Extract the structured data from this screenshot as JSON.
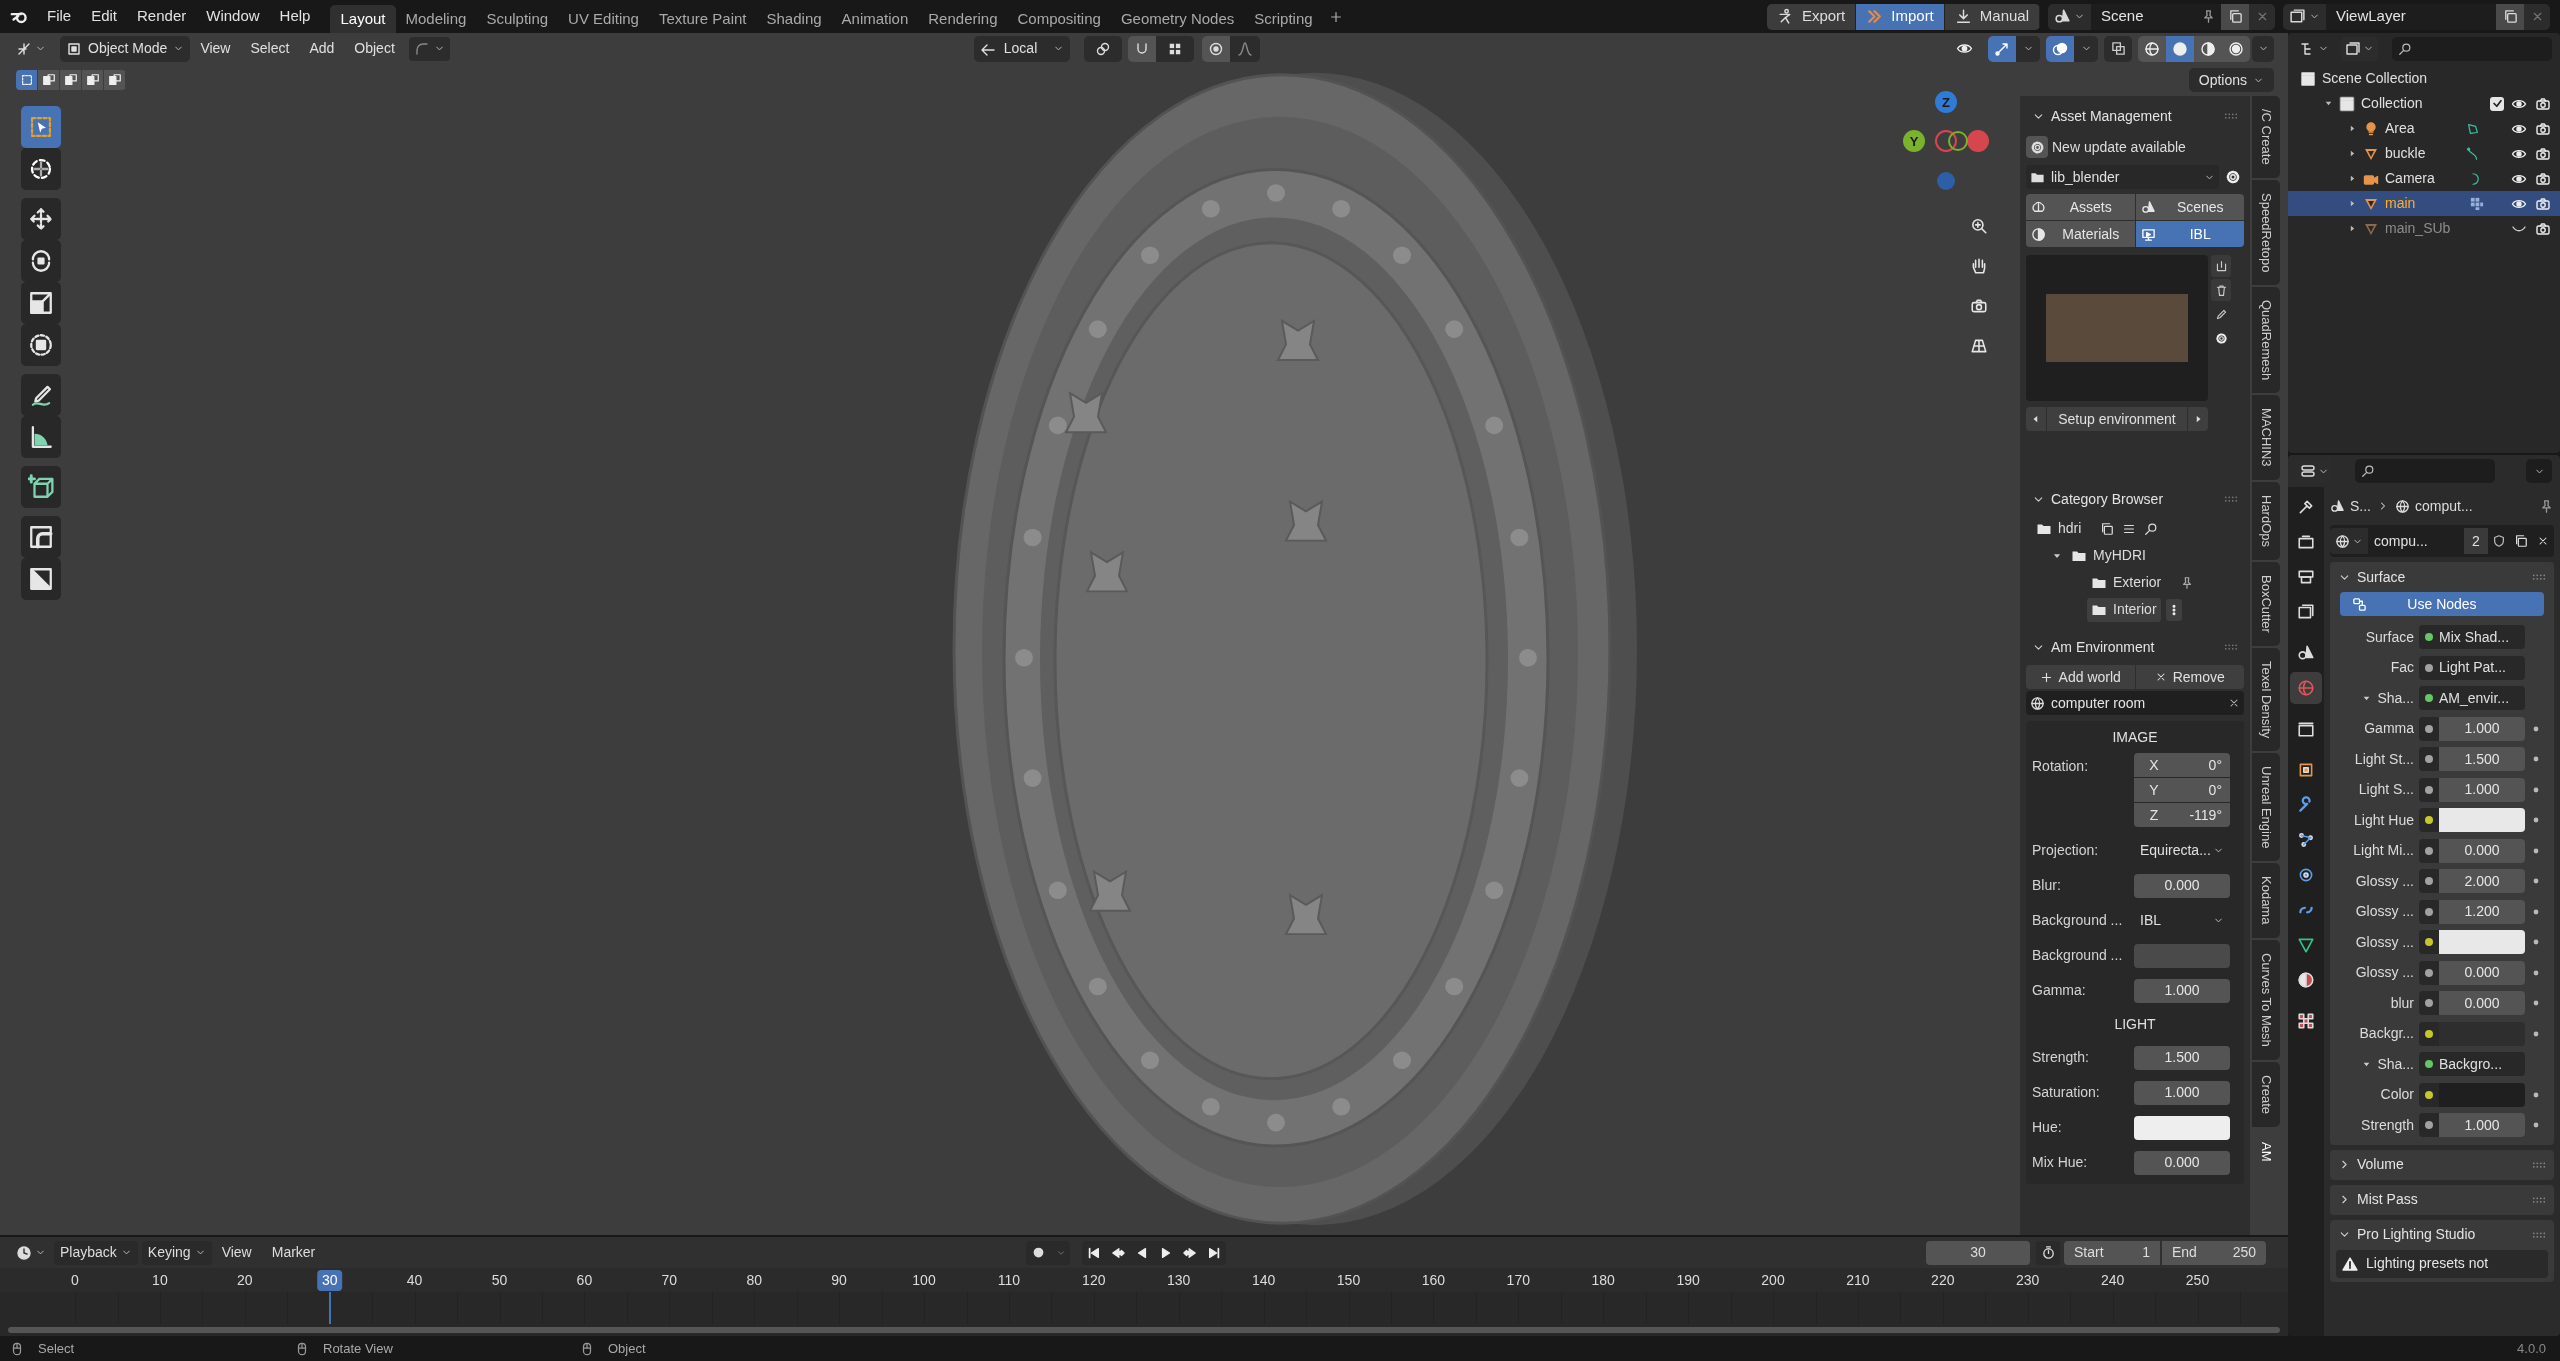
{
  "menu_bar": [
    "File",
    "Edit",
    "Render",
    "Window",
    "Help"
  ],
  "workspaces": [
    {
      "label": "Layout",
      "selected": true
    },
    {
      "label": "Modeling",
      "selected": false
    },
    {
      "label": "Sculpting",
      "selected": false
    },
    {
      "label": "UV Editing",
      "selected": false
    },
    {
      "label": "Texture Paint",
      "selected": false
    },
    {
      "label": "Shading",
      "selected": false
    },
    {
      "label": "Animation",
      "selected": false
    },
    {
      "label": "Rendering",
      "selected": false
    },
    {
      "label": "Compositing",
      "selected": false
    },
    {
      "label": "Geometry Nodes",
      "selected": false
    },
    {
      "label": "Scripting",
      "selected": false
    }
  ],
  "header_buttons": [
    {
      "label": "Export",
      "selected": false
    },
    {
      "label": "Import",
      "selected": true
    },
    {
      "label": "Manual",
      "selected": false
    }
  ],
  "scene": "Scene",
  "view_layer": "ViewLayer",
  "viewport_header": {
    "mode": "Object Mode",
    "menus": [
      "View",
      "Select",
      "Add",
      "Object"
    ],
    "orientation": "Local",
    "options": "Options"
  },
  "shading_modes": [
    {
      "selected": false
    },
    {
      "selected": true
    },
    {
      "selected": false
    },
    {
      "selected": false
    }
  ],
  "select_modes": [
    {
      "selected": true
    },
    {
      "selected": false
    },
    {
      "selected": false
    },
    {
      "selected": false
    },
    {
      "selected": false
    }
  ],
  "tools": [
    {
      "selected": true
    },
    {
      "selected": false
    },
    {
      "selected": false
    },
    {
      "selected": false
    },
    {
      "selected": false
    },
    {
      "selected": false
    },
    {
      "selected": false
    },
    {
      "selected": false
    },
    {
      "selected": false
    },
    {
      "selected": false
    },
    {
      "selected": false
    }
  ],
  "gizmo": {
    "axes": [
      "Z",
      "Y"
    ]
  },
  "n_panel": {
    "asset_management": {
      "title": "Asset Management",
      "expanded": true,
      "update_notice": "New update available",
      "library": "lib_blender",
      "tabs": [
        {
          "label": "Assets",
          "selected": false
        },
        {
          "label": "Scenes",
          "selected": false
        },
        {
          "label": "Materials",
          "selected": false
        },
        {
          "label": "IBL",
          "selected": true
        }
      ],
      "setup_button": "Setup environment"
    },
    "category_browser": {
      "title": "Category Browser",
      "expanded": true,
      "tree": [
        {
          "label": "hdri",
          "selected": false,
          "children": [
            {
              "label": "MyHDRI",
              "expanded": true,
              "selected": false,
              "children": [
                {
                  "label": "Exterior",
                  "selected": false
                },
                {
                  "label": "Interior",
                  "selected": true
                }
              ]
            }
          ]
        }
      ]
    },
    "am_environment": {
      "title": "Am Environment",
      "expanded": true,
      "add_button": "Add world",
      "remove_button": "Remove",
      "world": "computer room",
      "image_section": {
        "heading": "IMAGE",
        "rotation_label": "Rotation:",
        "rotation": [
          {
            "axis": "X",
            "value": "0°"
          },
          {
            "axis": "Y",
            "value": "0°"
          },
          {
            "axis": "Z",
            "value": "-119°"
          }
        ],
        "fields": [
          {
            "label": "Projection:",
            "kind": "dropdown",
            "value": "Equirecta..."
          },
          {
            "label": "Blur:",
            "kind": "number",
            "value": "0.000"
          },
          {
            "label": "Background ...",
            "kind": "dropdown",
            "value": "IBL"
          },
          {
            "label": "Background ...",
            "kind": "swatch",
            "swatch": {
              "color": "#4a4a4a"
            }
          },
          {
            "label": "Gamma:",
            "kind": "number",
            "value": "1.000"
          }
        ]
      },
      "light_section": {
        "heading": "LIGHT",
        "fields": [
          {
            "label": "Strength:",
            "kind": "number",
            "value": "1.500"
          },
          {
            "label": "Saturation:",
            "kind": "number",
            "value": "1.000"
          },
          {
            "label": "Hue:",
            "kind": "swatch",
            "swatch": {
              "color": "#eeeeee"
            }
          },
          {
            "label": "Mix Hue:",
            "kind": "number",
            "value": "0.000"
          }
        ]
      }
    }
  },
  "side_tabs": [
    {
      "label": "/C Create",
      "selected": false
    },
    {
      "label": "SpeedRetopo",
      "selected": false
    },
    {
      "label": "QuadRemesh",
      "selected": false
    },
    {
      "label": "MACHIN3",
      "selected": false
    },
    {
      "label": "HardOps",
      "selected": false
    },
    {
      "label": "BoxCutter",
      "selected": false
    },
    {
      "label": "Texel Density",
      "selected": false
    },
    {
      "label": "Unreal Engine",
      "selected": false
    },
    {
      "label": "Kodama",
      "selected": false
    },
    {
      "label": "Curves To Mesh",
      "selected": false
    },
    {
      "label": "Create",
      "selected": false
    },
    {
      "label": "AM",
      "selected": true
    }
  ],
  "outliner": {
    "tree": [
      {
        "label": "Scene Collection",
        "kind": "scene_collection",
        "children": [
          {
            "label": "Collection",
            "kind": "collection",
            "expanded": true,
            "checked": true,
            "visible": true,
            "children": [
              {
                "label": "Area",
                "kind": "light",
                "expanded": false,
                "selected": false,
                "visible": true,
                "modifiers": false
              },
              {
                "label": "buckle",
                "kind": "curve",
                "expanded": false,
                "selected": false,
                "visible": true,
                "modifiers": false
              },
              {
                "label": "Camera",
                "kind": "camera",
                "expanded": false,
                "selected": false,
                "visible": true,
                "modifiers": false
              },
              {
                "label": "main",
                "kind": "mesh",
                "expanded": false,
                "selected": true,
                "visible": true,
                "modifiers": true
              },
              {
                "label": "main_SUb",
                "kind": "mesh",
                "expanded": false,
                "selected": false,
                "visible": false,
                "modifiers": false
              }
            ]
          }
        ]
      }
    ]
  },
  "properties": {
    "tabs": [
      {
        "selected": false
      },
      {
        "selected": false
      },
      {
        "selected": false
      },
      {
        "selected": false
      },
      {
        "selected": false
      },
      {
        "selected": true
      },
      {
        "selected": false
      },
      {
        "selected": false
      },
      {
        "selected": false
      },
      {
        "selected": false
      },
      {
        "selected": false
      },
      {
        "selected": false
      },
      {
        "selected": false
      },
      {
        "selected": false
      },
      {
        "selected": false
      }
    ],
    "breadcrumb": [
      "S...",
      "comput..."
    ],
    "datablock": {
      "name": "compu...",
      "users": "2"
    },
    "panels": [
      {
        "title": "Surface",
        "expanded": true,
        "button": "Use Nodes",
        "rows": [
          {
            "label": "Surface",
            "kind": "link",
            "color": "#63c763",
            "value": "Mix Shad..."
          },
          {
            "label": "Fac",
            "kind": "link",
            "color": "#a1a1a1",
            "value": "Light Pat..."
          },
          {
            "label": "Sha...",
            "kind": "link",
            "color": "#63c763",
            "value": "AM_envir...",
            "expanded": true
          },
          {
            "label": "Gamma",
            "kind": "number",
            "color": "#a1a1a1",
            "value": "1.000"
          },
          {
            "label": "Light St...",
            "kind": "number",
            "color": "#a1a1a1",
            "value": "1.500"
          },
          {
            "label": "Light S...",
            "kind": "number",
            "color": "#a1a1a1",
            "value": "1.000"
          },
          {
            "label": "Light Hue",
            "kind": "swatch",
            "color": "#c7c729",
            "swatch": {
              "color": "#e8e8e8"
            }
          },
          {
            "label": "Light Mi...",
            "kind": "number",
            "color": "#a1a1a1",
            "value": "0.000"
          },
          {
            "label": "Glossy ...",
            "kind": "number",
            "color": "#a1a1a1",
            "value": "2.000"
          },
          {
            "label": "Glossy ...",
            "kind": "number",
            "color": "#a1a1a1",
            "value": "1.200"
          },
          {
            "label": "Glossy ...",
            "kind": "swatch",
            "color": "#c7c729",
            "swatch": {
              "color": "#e8e8e8"
            }
          },
          {
            "label": "Glossy ...",
            "kind": "number",
            "color": "#a1a1a1",
            "value": "0.000"
          },
          {
            "label": "blur",
            "kind": "number",
            "color": "#a1a1a1",
            "value": "0.000"
          },
          {
            "label": "Backgr...",
            "kind": "swatch",
            "color": "#c7c729",
            "swatch": {
              "color": "#2e2e2e"
            }
          },
          {
            "label": "Sha...",
            "kind": "link",
            "color": "#63c763",
            "value": "Backgro...",
            "expanded": true
          },
          {
            "label": "Color",
            "kind": "swatch",
            "color": "#c7c729",
            "swatch": {
              "color": "#1f1f1f"
            }
          },
          {
            "label": "Strength",
            "kind": "number",
            "color": "#a1a1a1",
            "value": "1.000"
          }
        ]
      },
      {
        "title": "Volume",
        "expanded": false
      },
      {
        "title": "Mist Pass",
        "expanded": false
      },
      {
        "title": "Pro Lighting Studio",
        "expanded": true,
        "warning": "Lighting presets not"
      }
    ]
  },
  "timeline": {
    "menus": [
      {
        "label": "Playback",
        "kind": "dropdown"
      },
      {
        "label": "Keying",
        "kind": "dropdown"
      },
      {
        "label": "View",
        "kind": "menu"
      },
      {
        "label": "Marker",
        "kind": "menu"
      }
    ],
    "current_frame": "30",
    "start_label": "Start",
    "start": "1",
    "end_label": "End",
    "end": "250",
    "ruler": [
      {
        "label": "0",
        "selected": false
      },
      {
        "label": "10",
        "selected": false
      },
      {
        "label": "20",
        "selected": false
      },
      {
        "label": "30",
        "selected": true
      },
      {
        "label": "40",
        "selected": false
      },
      {
        "label": "50",
        "selected": false
      },
      {
        "label": "60",
        "selected": false
      },
      {
        "label": "70",
        "selected": false
      },
      {
        "label": "80",
        "selected": false
      },
      {
        "label": "90",
        "selected": false
      },
      {
        "label": "100",
        "selected": false
      },
      {
        "label": "110",
        "selected": false
      },
      {
        "label": "120",
        "selected": false
      },
      {
        "label": "130",
        "selected": false
      },
      {
        "label": "140",
        "selected": false
      },
      {
        "label": "150",
        "selected": false
      },
      {
        "label": "160",
        "selected": false
      },
      {
        "label": "170",
        "selected": false
      },
      {
        "label": "180",
        "selected": false
      },
      {
        "label": "190",
        "selected": false
      },
      {
        "label": "200",
        "selected": false
      },
      {
        "label": "210",
        "selected": false
      },
      {
        "label": "220",
        "selected": false
      },
      {
        "label": "230",
        "selected": false
      },
      {
        "label": "240",
        "selected": false
      },
      {
        "label": "250",
        "selected": false
      }
    ]
  },
  "status_bar": {
    "hints": [
      "Select",
      "Rotate View",
      "Object"
    ],
    "version": "4.0.0"
  }
}
